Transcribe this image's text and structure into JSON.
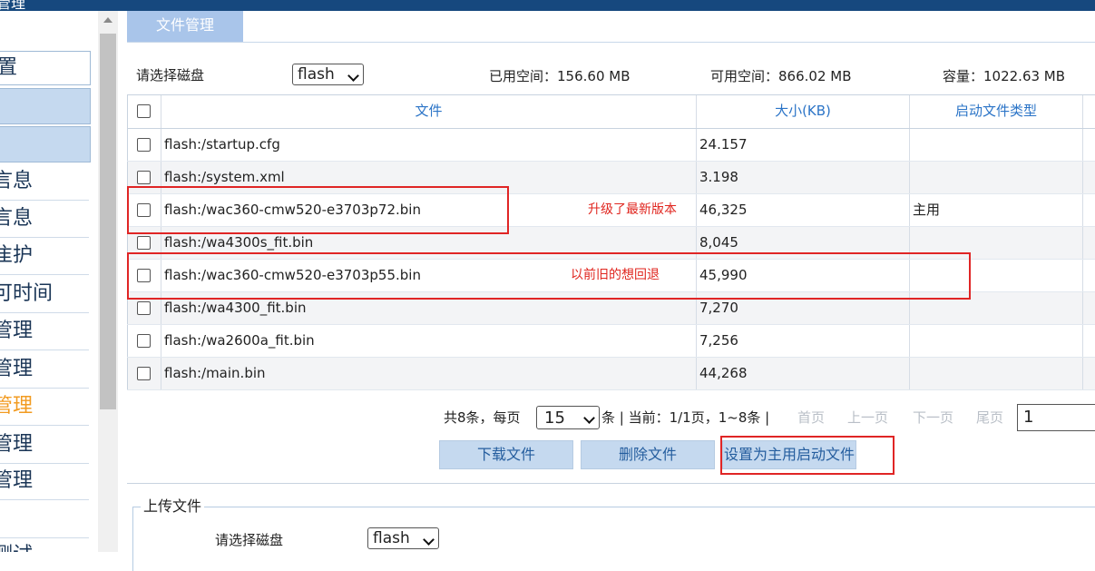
{
  "window": {
    "title": "管理"
  },
  "sidebar": {
    "items": [
      {
        "label": "置",
        "style": "boxed"
      },
      {
        "label": "",
        "style": "blue"
      },
      {
        "label": "",
        "style": "blue"
      },
      {
        "label": "言息"
      },
      {
        "label": "言息"
      },
      {
        "label": "隹护"
      },
      {
        "label": "可时间"
      },
      {
        "label": "管理"
      },
      {
        "label": "管理"
      },
      {
        "label": "管理",
        "active": true
      },
      {
        "label": "管理"
      },
      {
        "label": "管理"
      },
      {
        "label": ""
      },
      {
        "label": "测试"
      }
    ]
  },
  "tab": {
    "label": "文件管理"
  },
  "disk": {
    "label": "请选择磁盘",
    "selected": "flash",
    "used": "已用空间：156.60 MB",
    "free": "可用空间：866.02 MB",
    "capacity": "容量：1022.63 MB"
  },
  "table": {
    "headers": [
      "文件",
      "大小(KB)",
      "启动文件类型"
    ],
    "rows": [
      {
        "file": "flash:/startup.cfg",
        "size": "24.157",
        "type": ""
      },
      {
        "file": "flash:/system.xml",
        "size": "3.198",
        "type": ""
      },
      {
        "file": "flash:/wac360-cmw520-e3703p72.bin",
        "size": "46,325",
        "type": "主用"
      },
      {
        "file": "flash:/wa4300s_fit.bin",
        "size": "8,045",
        "type": ""
      },
      {
        "file": "flash:/wac360-cmw520-e3703p55.bin",
        "size": "45,990",
        "type": ""
      },
      {
        "file": "flash:/wa4300_fit.bin",
        "size": "7,270",
        "type": ""
      },
      {
        "file": "flash:/wa2600a_fit.bin",
        "size": "7,256",
        "type": ""
      },
      {
        "file": "flash:/main.bin",
        "size": "44,268",
        "type": ""
      }
    ],
    "annotations": {
      "upgraded": "升级了最新版本",
      "rollback": "以前旧的想回退"
    }
  },
  "pager": {
    "total_prefix": "共8条，每页",
    "per_page": "15",
    "summary": "条 | 当前：1/1页，1~8条 |",
    "first": "首页",
    "prev": "上一页",
    "next": "下一页",
    "last": "尾页",
    "page_input": "1"
  },
  "actions": {
    "download": "下载文件",
    "delete": "删除文件",
    "set_main": "设置为主用启动文件"
  },
  "upload": {
    "legend": "上传文件",
    "disk_label": "请选择磁盘",
    "disk_selected": "flash"
  },
  "colors": {
    "header_bar": "#16487e",
    "tab_bg": "#a9c5ea",
    "button_bg": "#c5d9ef",
    "highlight_red": "#e02525",
    "active_orange": "#f29b21"
  }
}
